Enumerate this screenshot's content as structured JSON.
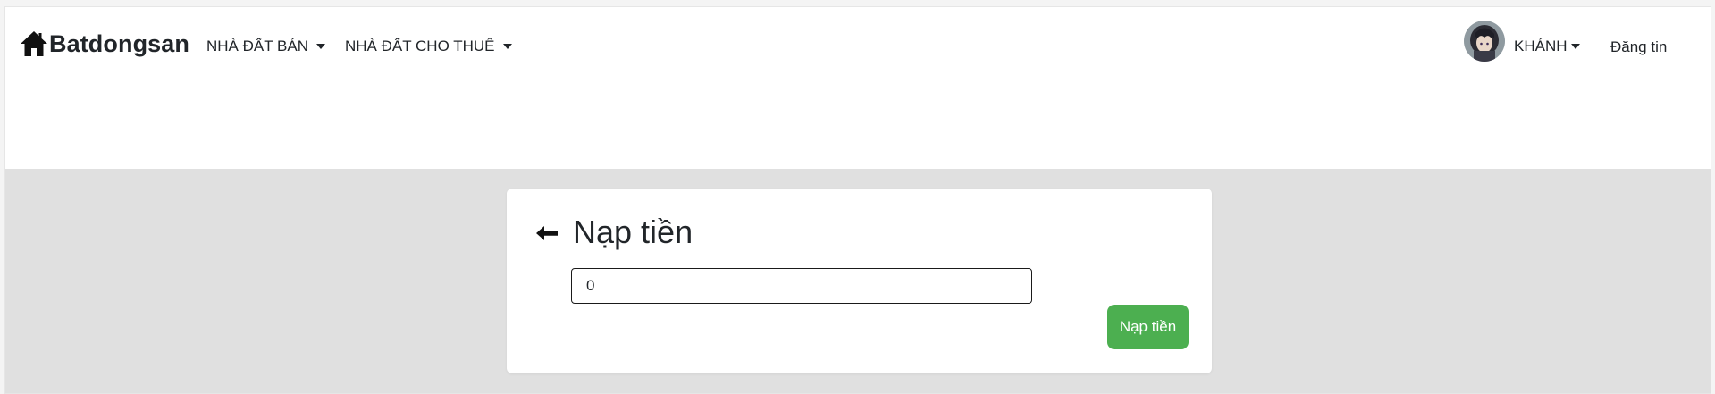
{
  "navbar": {
    "brand": {
      "icon": "home-icon",
      "text": "Batdongsan"
    },
    "menu": [
      {
        "label": "NHÀ ĐẤT BÁN",
        "has_dropdown": true
      },
      {
        "label": "NHÀ ĐẤT CHO THUÊ",
        "has_dropdown": true
      }
    ],
    "user": {
      "name": "KHÁNH",
      "has_dropdown": true,
      "avatar": "user-avatar"
    },
    "post_label": "Đăng tin"
  },
  "deposit": {
    "title": "Nạp tiền",
    "back_icon": "arrow-left-icon",
    "amount_value": "0",
    "submit_label": "Nạp tiền"
  },
  "colors": {
    "page_background": "#e0e0e0",
    "card_background": "#ffffff",
    "submit_button": "#4caf50",
    "text": "#212529"
  }
}
